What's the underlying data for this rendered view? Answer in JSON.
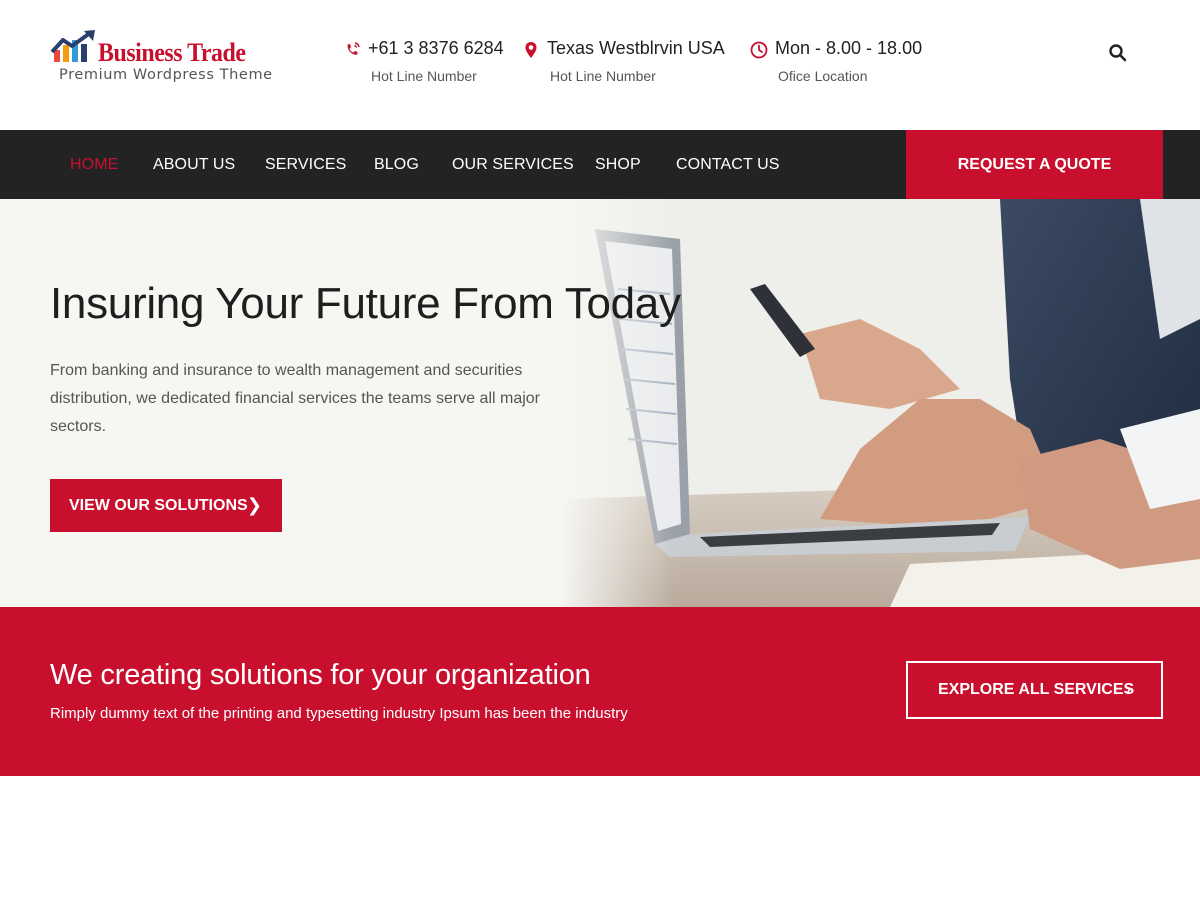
{
  "brand": {
    "title": "Business Trade",
    "subtitle": "Premium Wordpress Theme"
  },
  "contact": [
    {
      "icon": "phone-icon",
      "value": "+61 3 8376 6284",
      "label": "Hot Line Number"
    },
    {
      "icon": "map-pin-icon",
      "value": "Texas Westblrvin USA",
      "label": "Hot Line Number"
    },
    {
      "icon": "clock-icon",
      "value": "Mon - 8.00 - 18.00",
      "label": "Ofice Location"
    }
  ],
  "header": {
    "search_icon": "search-icon"
  },
  "nav": {
    "items": [
      "HOME",
      "ABOUT US",
      "SERVICES",
      "BLOG",
      "OUR SERVICES",
      "SHOP",
      "CONTACT US"
    ],
    "active": "HOME",
    "cta": "REQUEST A QUOTE"
  },
  "hero": {
    "title": "Insuring Your Future From Today",
    "text": "From banking and insurance to wealth management and securities distribution, we dedicated financial services the teams serve all major sectors.",
    "button": "VIEW OUR SOLUTIONS",
    "button_icon": "chevron-right-icon"
  },
  "band": {
    "title": "We creating solutions for your organization",
    "text": "Rimply dummy text of the printing and typesetting industry Ipsum has been the industry",
    "button": "EXPLORE ALL SERVICES",
    "button_icon": "chevron-right-icon"
  },
  "colors": {
    "accent": "#c8102e",
    "nav_bg": "#232323",
    "hero_bg": "#f6f6f3",
    "logo_blue": "#2b3f6c"
  }
}
